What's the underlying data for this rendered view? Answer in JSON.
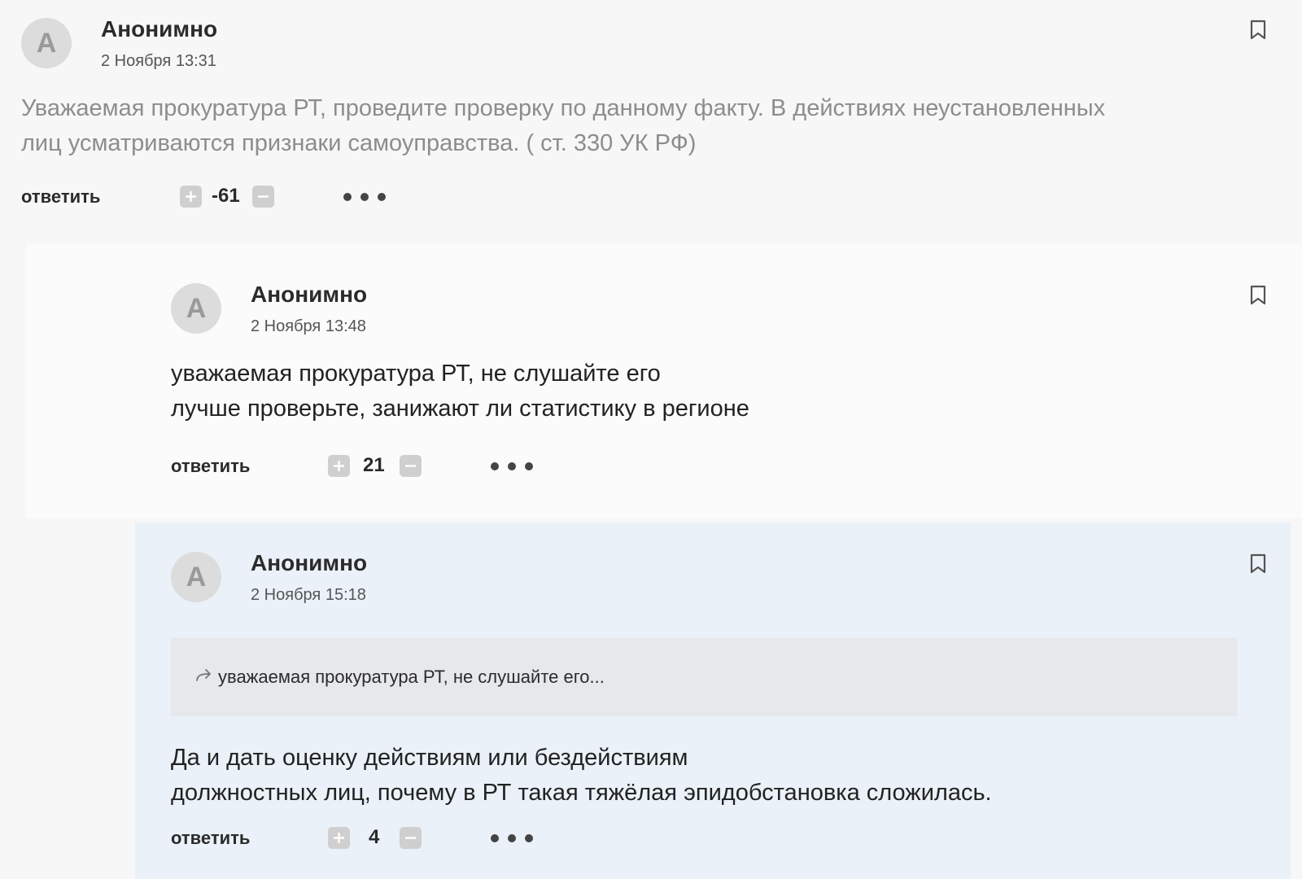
{
  "comments": [
    {
      "avatar_letter": "А",
      "author": "Анонимно",
      "date": "2 Ноября 13:31",
      "text_lines": [
        "Уважаемая прокуратура РТ, проведите проверку по данному факту. В действиях неустановленных",
        "лиц усматриваются признаки самоуправства. ( ст. 330 УК РФ)"
      ],
      "reply_label": "ответить",
      "score": "-61"
    },
    {
      "avatar_letter": "А",
      "author": "Анонимно",
      "date": "2 Ноября 13:48",
      "text_lines": [
        "уважаемая прокуратура РТ, не слушайте его",
        "лучше проверьте, занижают ли статистику в регионе"
      ],
      "reply_label": "ответить",
      "score": "21"
    },
    {
      "avatar_letter": "А",
      "author": "Анонимно",
      "date": "2 Ноября 15:18",
      "quote": "уважаемая прокуратура РТ, не слушайте его...",
      "text_lines": [
        "Да и дать оценку действиям или бездействиям",
        "должностных лиц, почему в РТ такая тяжёлая эпидобстановка сложилась."
      ],
      "reply_label": "ответить",
      "score": "4"
    }
  ],
  "colors": {
    "page_background": "#f7f7f7",
    "highlighted_comment": "#eaf1f8",
    "muted_text": "#8d8d8d",
    "vote_button": "#cfcfcf"
  },
  "icons": {
    "bookmark": "bookmark-icon",
    "upvote": "plus-icon",
    "downvote": "minus-icon",
    "more": "more-dots-icon",
    "quote": "reply-arrow-icon"
  }
}
